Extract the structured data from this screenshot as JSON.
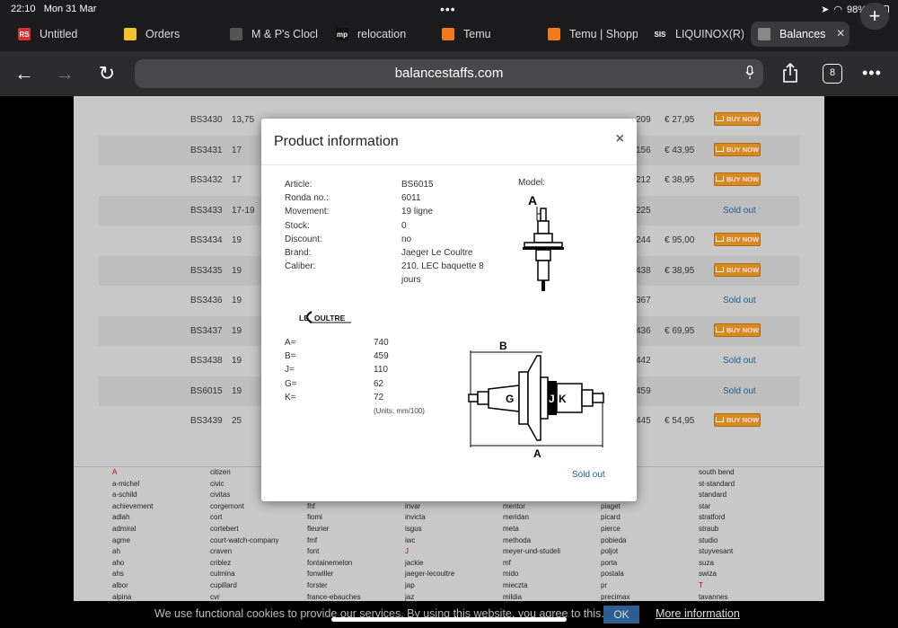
{
  "status_bar": {
    "time": "22:10",
    "date": "Mon 31 Mar",
    "battery": "98%"
  },
  "tabs": [
    {
      "label": "Untitled",
      "fav_text": "RS",
      "fav_color": "#d9322e"
    },
    {
      "label": "Orders",
      "fav_text": "",
      "fav_color": "#f2c12e"
    },
    {
      "label": "M & P's Clocl",
      "fav_text": "",
      "fav_color": "#555555"
    },
    {
      "label": "relocation",
      "fav_text": "mp",
      "fav_color": "#111111"
    },
    {
      "label": "Temu",
      "fav_text": "",
      "fav_color": "#f47a1f"
    },
    {
      "label": "Temu | Shopp",
      "fav_text": "",
      "fav_color": "#f47a1f"
    },
    {
      "label": "LIQUINOX(R)",
      "fav_text": "SIS",
      "fav_color": "#1c1c1e"
    },
    {
      "label": "Balances",
      "fav_text": "",
      "fav_color": "#888888"
    }
  ],
  "toolbar": {
    "url": "balancestaffs.com",
    "tab_count": "8"
  },
  "product_rows": [
    {
      "article": "BS3430",
      "size": "13,75",
      "num": "209",
      "price": "€ 27,95",
      "status": "buy"
    },
    {
      "article": "BS3431",
      "size": "17",
      "num": "156",
      "price": "€ 43,95",
      "status": "buy"
    },
    {
      "article": "BS3432",
      "size": "17",
      "num": "212",
      "price": "€ 38,95",
      "status": "buy"
    },
    {
      "article": "BS3433",
      "size": "17-19",
      "num": "225",
      "price": "",
      "status": "sold"
    },
    {
      "article": "BS3434",
      "size": "19",
      "num": "244",
      "price": "€ 95,00",
      "status": "buy"
    },
    {
      "article": "BS3435",
      "size": "19",
      "num": "438",
      "price": "€ 38,95",
      "status": "buy"
    },
    {
      "article": "BS3436",
      "size": "19",
      "num": "367",
      "price": "",
      "status": "sold"
    },
    {
      "article": "BS3437",
      "size": "19",
      "num": "436",
      "price": "€ 69,95",
      "status": "buy"
    },
    {
      "article": "BS3438",
      "size": "19",
      "num": "442",
      "price": "",
      "status": "sold"
    },
    {
      "article": "BS6015",
      "size": "19",
      "num": "459",
      "price": "",
      "status": "sold"
    },
    {
      "article": "BS3439",
      "size": "25",
      "num": "445",
      "price": "€ 54,95",
      "status": "buy"
    }
  ],
  "labels": {
    "buy_now": "BUY NOW",
    "sold_out": "Sold out"
  },
  "brand_columns": [
    [
      "A",
      "a-michel",
      "a-schild",
      "achievement",
      "adlah",
      "admiral",
      "agme",
      "ah",
      "aho",
      "ahs",
      "albor",
      "alpina"
    ],
    [
      "citizen",
      "civic",
      "civitas",
      "corgemont",
      "cort",
      "cortebert",
      "court-watch-company",
      "craven",
      "criblez",
      "culmina",
      "cupillard",
      "cvr"
    ],
    [
      "fhf",
      "fiomi",
      "fleurier",
      "fmf",
      "font",
      "fontainemelon",
      "fonwiller",
      "forster",
      "france-ebauches"
    ],
    [
      "invar",
      "invicta",
      "isgus",
      "iwc",
      "J",
      "jackie",
      "jaeger-lecoultre",
      "jap",
      "jaz"
    ],
    [
      "mentor",
      "meridan",
      "meta",
      "methoda",
      "meyer-und-studeli",
      "mf",
      "mido",
      "mieczta",
      "mildia"
    ],
    [
      "piaget",
      "picard",
      "pierce",
      "pobieda",
      "poljot",
      "porta",
      "postala",
      "pr",
      "precimax"
    ],
    [
      "south bend",
      "st-standard",
      "standard",
      "star",
      "stratford",
      "straub",
      "studio",
      "stuyvesant",
      "suza",
      "swiza",
      "T",
      "tavannes"
    ]
  ],
  "modal": {
    "title": "Product information",
    "close": "×",
    "info_labels": [
      "Article:",
      "Ronda no.:",
      "Movement:",
      "Stock:",
      "Discount:",
      "Brand:",
      "Caliber:"
    ],
    "info_values": [
      "BS6015",
      "6011",
      "19 ligne",
      "0",
      "no",
      "Jaeger Le Coultre",
      "210, LEC baquette 8 jours"
    ],
    "model_label": "Model:",
    "brand_logo": "LE COULTRE",
    "dim_labels": [
      "A=",
      "B=",
      "J=",
      "G=",
      "K="
    ],
    "dim_values": [
      "740",
      "459",
      "110",
      "62",
      "72"
    ],
    "units": "(Units: mm/100)",
    "diagram_letters": {
      "a": "A",
      "b": "B",
      "g": "G",
      "j": "J",
      "k": "K"
    },
    "status": "Sold out"
  },
  "cookie": {
    "message": "We use functional cookies to provide our services. By using this website, you agree to this.",
    "ok": "OK",
    "more": "More information"
  }
}
